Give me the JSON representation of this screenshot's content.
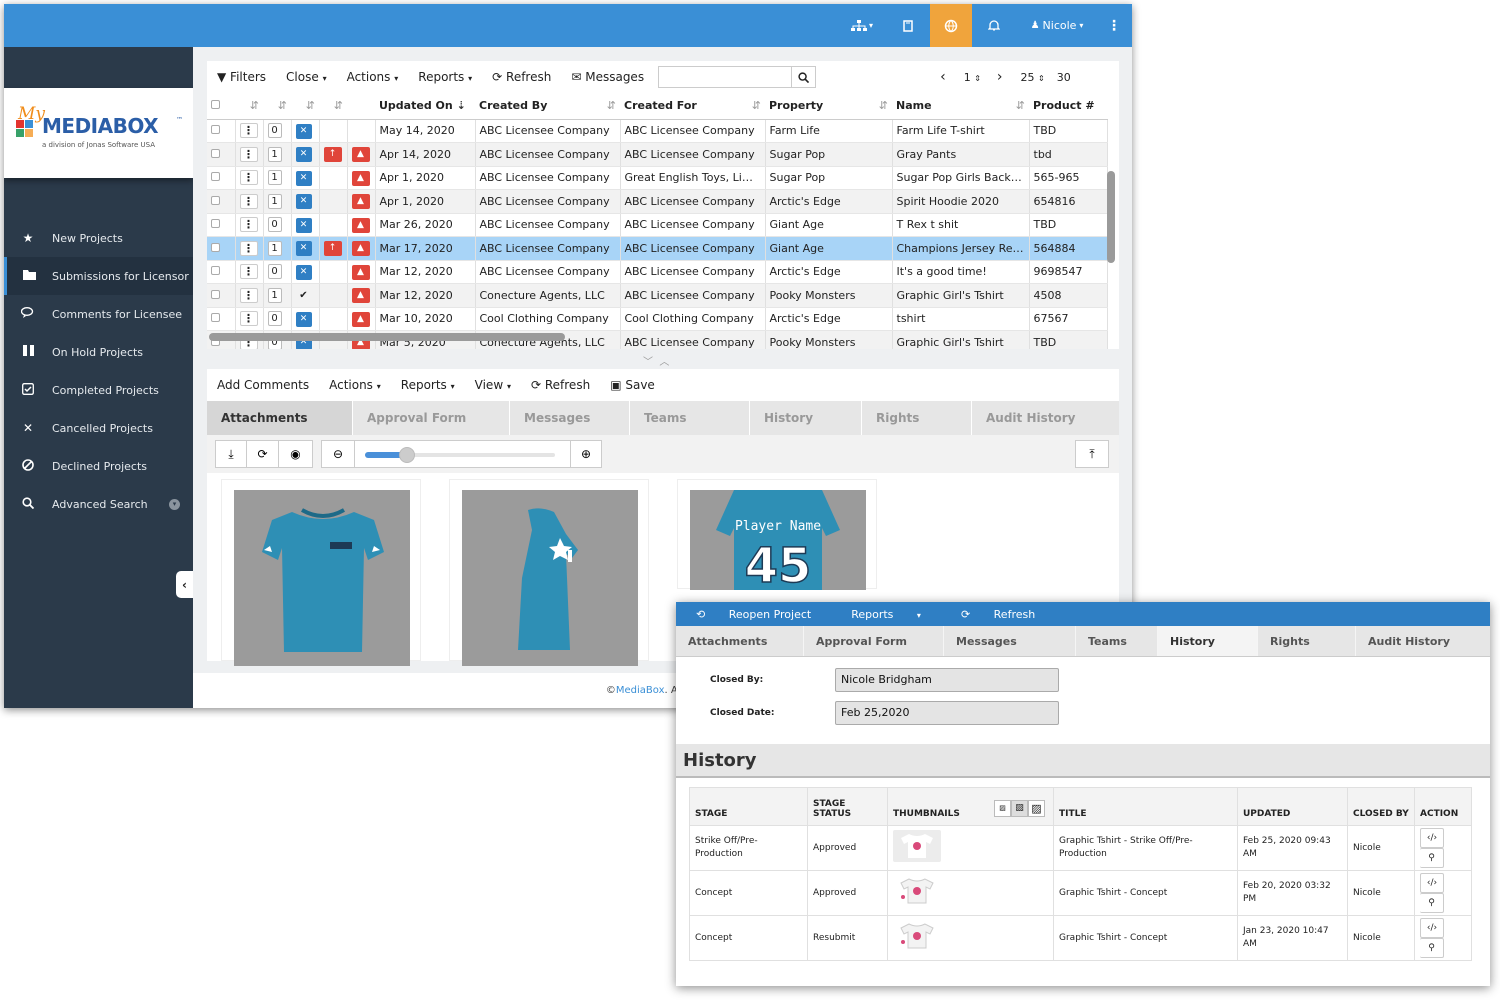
{
  "topbar": {
    "user_name": "Nicole"
  },
  "logo": {
    "my": "My",
    "name": "MEDIABOX",
    "tm": "™",
    "tagline": "a division of Jonas Software USA"
  },
  "sidebar": {
    "items": [
      {
        "label": "New Projects",
        "icon": "star-icon"
      },
      {
        "label": "Submissions for Licensor",
        "icon": "folder-icon"
      },
      {
        "label": "Comments for Licensee",
        "icon": "comments-icon"
      },
      {
        "label": "On Hold Projects",
        "icon": "pause-icon"
      },
      {
        "label": "Completed Projects",
        "icon": "check-square-icon"
      },
      {
        "label": "Cancelled Projects",
        "icon": "x-icon"
      },
      {
        "label": "Declined Projects",
        "icon": "ban-icon"
      },
      {
        "label": "Advanced Search",
        "icon": "search-icon"
      }
    ]
  },
  "toolbar1": {
    "filters": "Filters",
    "close": "Close",
    "actions": "Actions",
    "reports": "Reports",
    "refresh": "Refresh",
    "messages": "Messages",
    "search_placeholder": "",
    "page": "1",
    "page_size": "25",
    "total": "30"
  },
  "grid": {
    "columns": [
      "Updated On",
      "Created By",
      "Created For",
      "Property",
      "Name",
      "Product #"
    ],
    "rows": [
      {
        "count": "0",
        "status": "x",
        "flag": false,
        "alert": false,
        "updated": "May 14, 2020",
        "created_by": "ABC Licensee Company",
        "created_for": "ABC Licensee Company",
        "property": "Farm Life",
        "name": "Farm Life T-shirt",
        "product": "TBD"
      },
      {
        "count": "1",
        "status": "x",
        "flag": true,
        "alert": true,
        "updated": "Apr 14, 2020",
        "created_by": "ABC Licensee Company",
        "created_for": "ABC Licensee Company",
        "property": "Sugar Pop",
        "name": "Gray Pants",
        "product": "tbd"
      },
      {
        "count": "1",
        "status": "x",
        "flag": false,
        "alert": true,
        "updated": "Apr 1, 2020",
        "created_by": "ABC Licensee Company",
        "created_for": "Great English Toys, Limit...",
        "property": "Sugar Pop",
        "name": "Sugar Pop Girls Backpack",
        "product": "565-965"
      },
      {
        "count": "1",
        "status": "x",
        "flag": false,
        "alert": true,
        "updated": "Apr 1, 2020",
        "created_by": "ABC Licensee Company",
        "created_for": "ABC Licensee Company",
        "property": "Arctic's Edge",
        "name": "Spirit Hoodie 2020",
        "product": "654816"
      },
      {
        "count": "0",
        "status": "x",
        "flag": false,
        "alert": true,
        "updated": "Mar 26, 2020",
        "created_by": "ABC Licensee Company",
        "created_for": "ABC Licensee Company",
        "property": "Giant Age",
        "name": "T Rex t shit",
        "product": "TBD"
      },
      {
        "count": "1",
        "status": "x",
        "flag": true,
        "alert": true,
        "updated": "Mar 17, 2020",
        "created_by": "ABC Licensee Company",
        "created_for": "ABC Licensee Company",
        "property": "Giant Age",
        "name": "Champions Jersey Reta...",
        "product": "564884"
      },
      {
        "count": "0",
        "status": "x",
        "flag": false,
        "alert": true,
        "updated": "Mar 12, 2020",
        "created_by": "ABC Licensee Company",
        "created_for": "ABC Licensee Company",
        "property": "Arctic's Edge",
        "name": "It's a good time!",
        "product": "9698547"
      },
      {
        "count": "1",
        "status": "check",
        "flag": false,
        "alert": true,
        "updated": "Mar 12, 2020",
        "created_by": "Conecture Agents, LLC",
        "created_for": "ABC Licensee Company",
        "property": "Pooky Monsters",
        "name": "Graphic Girl's Tshirt",
        "product": "4508"
      },
      {
        "count": "0",
        "status": "x",
        "flag": false,
        "alert": true,
        "updated": "Mar 10, 2020",
        "created_by": "Cool Clothing Company",
        "created_for": "Cool Clothing Company",
        "property": "Arctic's Edge",
        "name": "tshirt",
        "product": "67567"
      },
      {
        "count": "0",
        "status": "x",
        "flag": false,
        "alert": true,
        "updated": "Mar 5, 2020",
        "created_by": "Conecture Agents, LLC",
        "created_for": "ABC Licensee Company",
        "property": "Pooky Monsters",
        "name": "Graphic Girl's Tshirt",
        "product": "TBD"
      }
    ]
  },
  "toolbar2": {
    "add_comments": "Add Comments",
    "actions": "Actions",
    "reports": "Reports",
    "view": "View",
    "refresh": "Refresh",
    "save": "Save"
  },
  "tabs": [
    "Attachments",
    "Approval Form",
    "Messages",
    "Teams",
    "History",
    "Rights",
    "Audit History"
  ],
  "zoom": {
    "level": 0.4
  },
  "jersey": {
    "player_name": "Player Name",
    "number": "45"
  },
  "footer": {
    "prefix": "© ",
    "link": "MediaBox",
    "suffix": ". A division"
  },
  "popup": {
    "bar": {
      "reopen": "Reopen Project",
      "reports": "Reports",
      "refresh": "Refresh"
    },
    "tabs": [
      "Attachments",
      "Approval Form",
      "Messages",
      "Teams",
      "History",
      "Rights",
      "Audit History"
    ],
    "closed_by_label": "Closed By:",
    "closed_by": "Nicole Bridgham",
    "closed_date_label": "Closed Date:",
    "closed_date": "Feb 25,2020",
    "history_title": "History",
    "history_columns": [
      "STAGE",
      "STAGE STATUS",
      "THUMBNAILS",
      "TITLE",
      "UPDATED",
      "CLOSED BY",
      "ACTION"
    ],
    "history_rows": [
      {
        "stage": "Strike Off/Pre-Production",
        "status": "Approved",
        "title": "Graphic Tshirt - Strike Off/Pre-Production",
        "updated": "Feb 25, 2020 09:43 AM",
        "closed_by": "Nicole"
      },
      {
        "stage": "Concept",
        "status": "Approved",
        "title": "Graphic Tshirt - Concept",
        "updated": "Feb 20, 2020 03:32 PM",
        "closed_by": "Nicole"
      },
      {
        "stage": "Concept",
        "status": "Resubmit",
        "title": "Graphic Tshirt - Concept",
        "updated": "Jan 23, 2020 10:47 AM",
        "closed_by": "Nicole"
      }
    ]
  },
  "colors": {
    "topbar": "#3a8fd6",
    "sidebar": "#2b3a4a",
    "accent_orange": "#f0a43c",
    "selected_row": "#a8d4f7",
    "alert_red": "#e0453a",
    "status_blue": "#2f7fc4",
    "shirt": "#2e8fb5"
  }
}
